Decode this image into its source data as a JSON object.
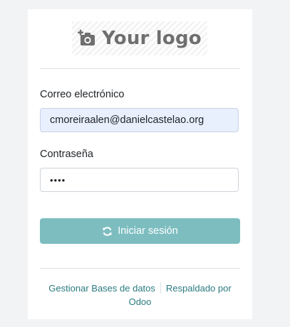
{
  "logo": {
    "text": "Your logo",
    "icon": "camera-add-icon"
  },
  "form": {
    "email_label": "Correo electrónico",
    "email_value": "cmoreiraalen@danielcastelao.org",
    "password_label": "Contraseña",
    "password_value": "••••",
    "submit_label": "Iniciar sesión",
    "submit_icon": "refresh-icon"
  },
  "footer": {
    "manage_db": "Gestionar Bases de datos",
    "powered_by_prefix": "Respaldado por",
    "powered_by_brand": "Odoo"
  },
  "colors": {
    "background": "#f2f3f4",
    "card": "#ffffff",
    "email_autofill_bg": "#e8f0fe",
    "primary_button": "#7dbdc0",
    "link": "#2b7a7f"
  }
}
